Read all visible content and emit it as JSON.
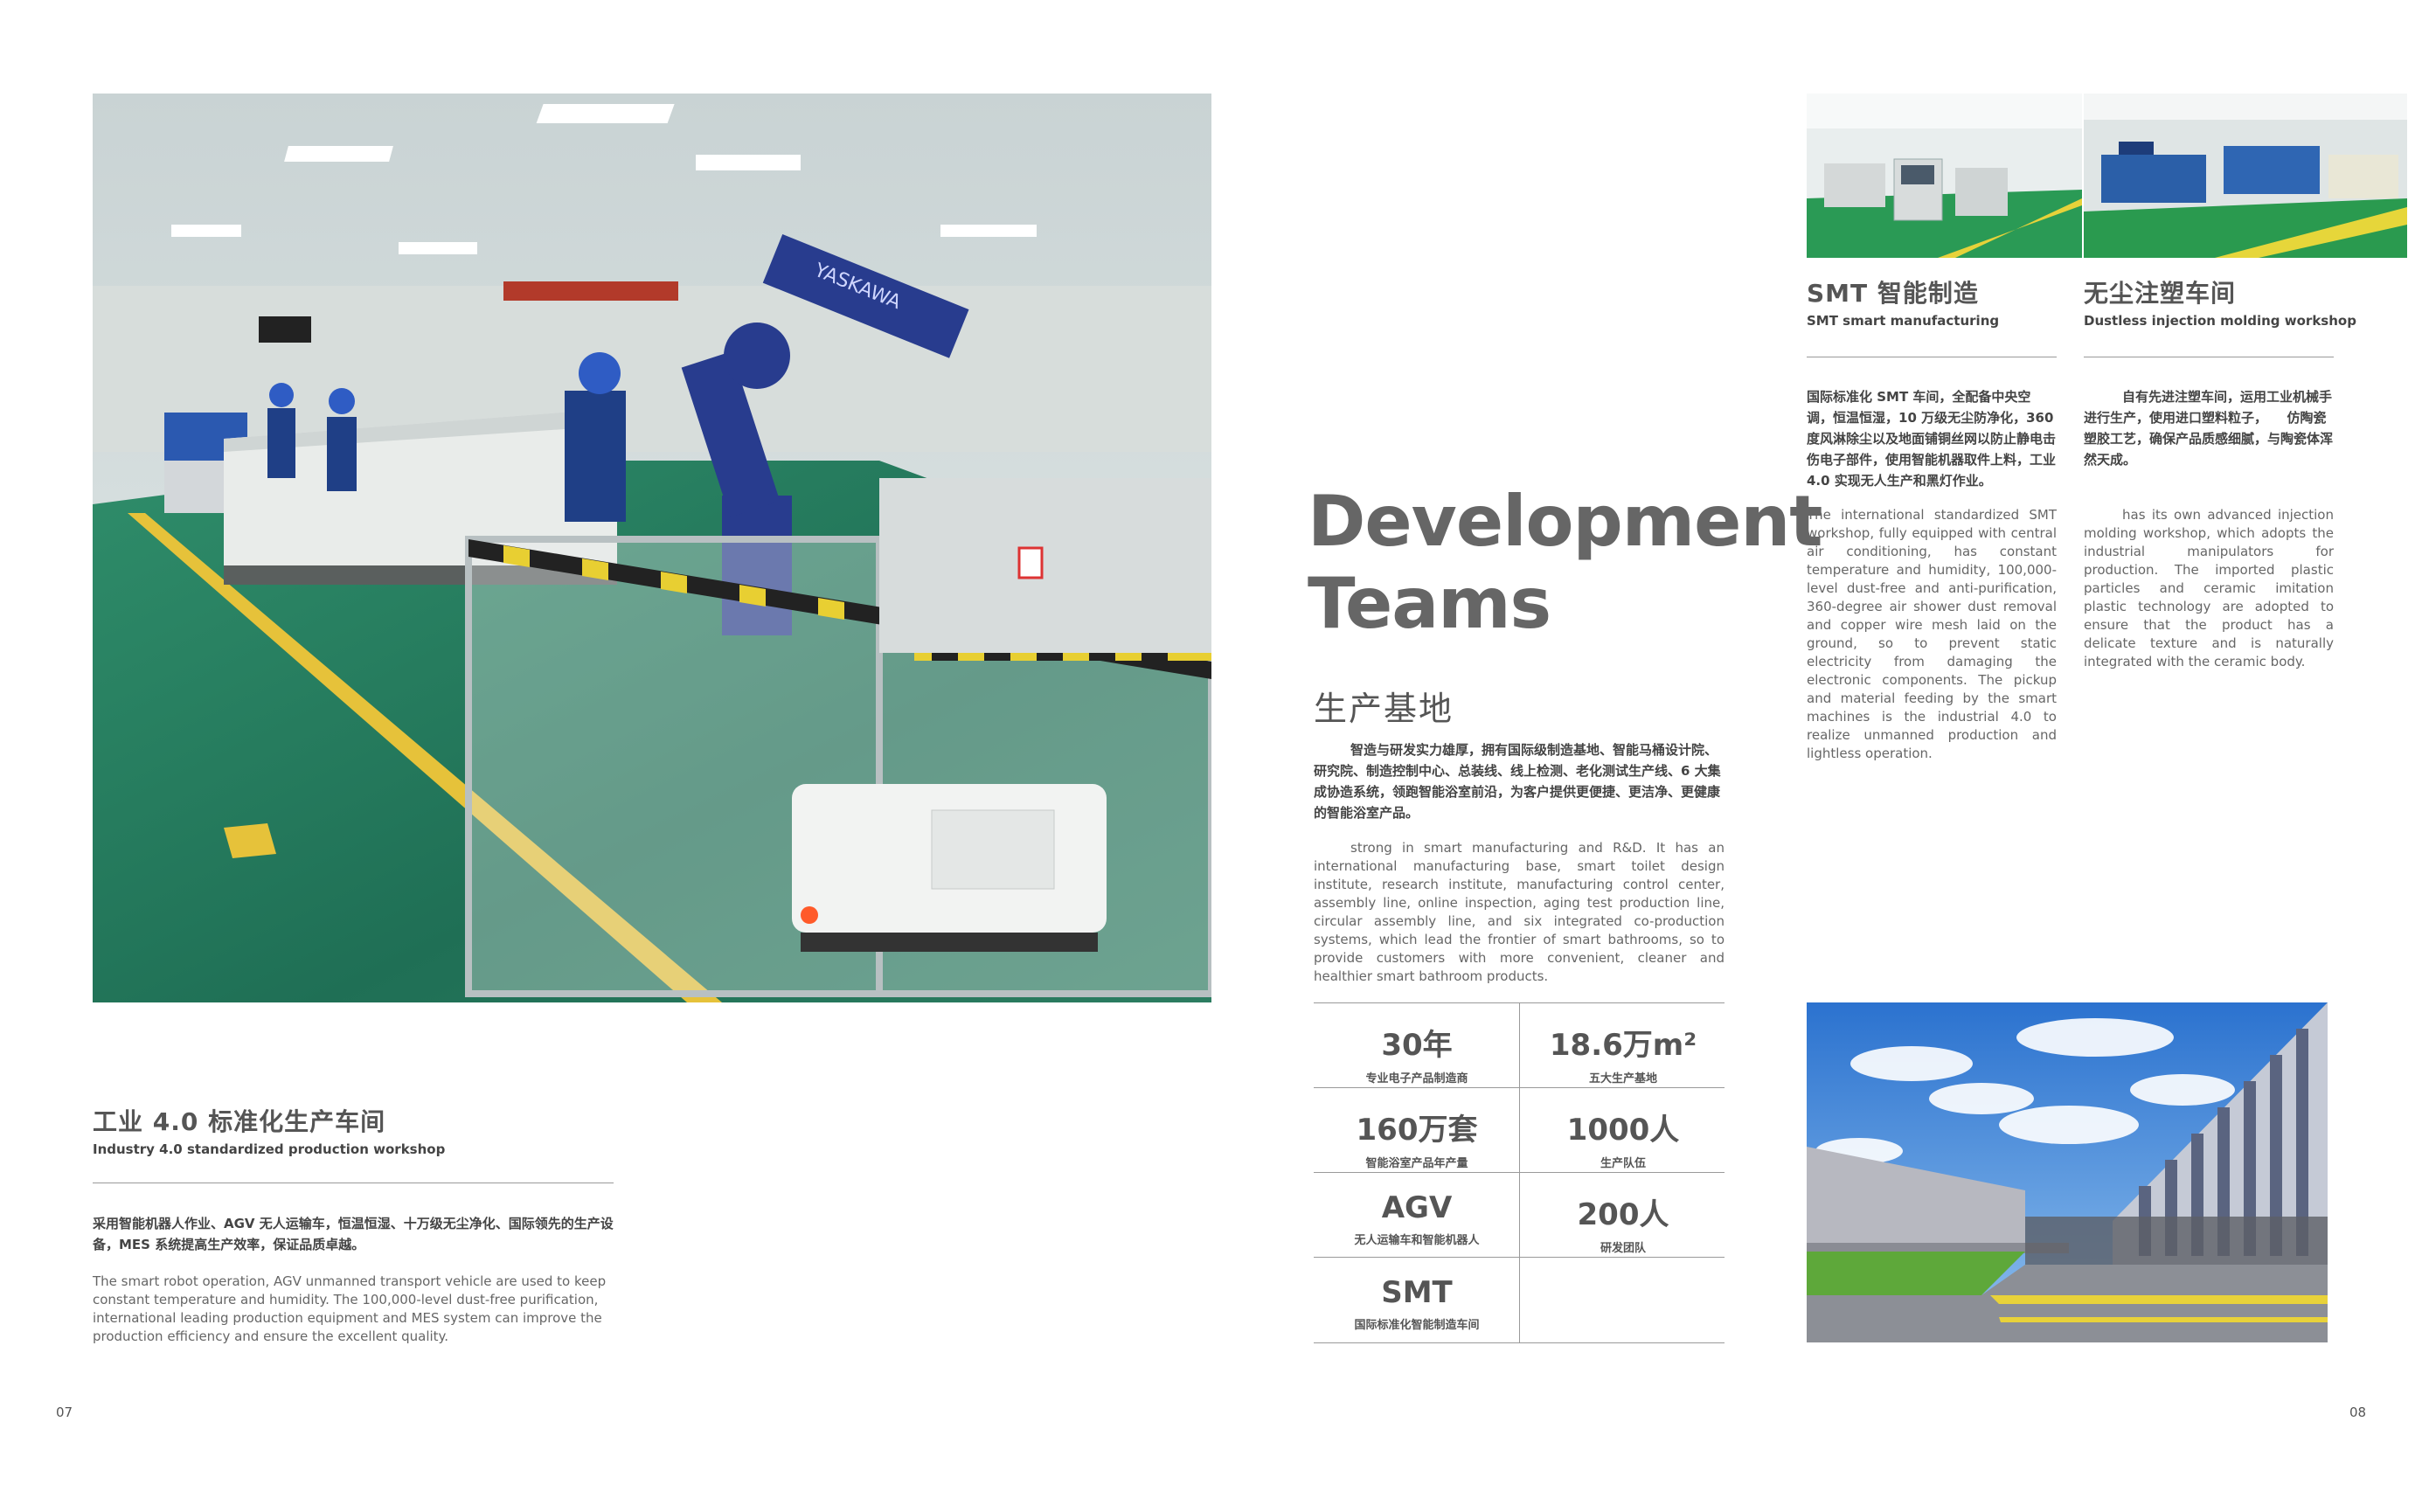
{
  "left_page": {
    "workshop_title_cn": "工业 4.0 标准化生产车间",
    "workshop_title_en": "Industry 4.0 standardized production workshop",
    "workshop_desc_cn": "采用智能机器人作业、AGV 无人运输车，恒温恒湿、十万级无尘净化、国际领先的生产设备，MES 系统提高生产效率，保证品质卓越。",
    "workshop_desc_en": "The smart robot operation, AGV unmanned transport vehicle are used to keep constant temperature and humidity. The 100,000-level dust-free purification, international leading production equipment and MES system can improve the production efficiency and ensure the excellent quality.",
    "page_number": "07",
    "robot_text": "YASKAWA"
  },
  "center": {
    "heading_line1": "Development",
    "heading_line2": "Teams",
    "section_cn": "生产基地",
    "intro_cn": "智造与研发实力雄厚，拥有国际级制造基地、智能马桶设计院、研究院、制造控制中心、总装线、线上检测、老化测试生产线、6 大集成协造系统，领跑智能浴室前沿，为客户提供更便捷、更洁净、更健康的智能浴室产品。",
    "intro_en": "strong in smart manufacturing and R&D. It has an international manufacturing base, smart toilet design institute, research institute, manufacturing control center, assembly line, online inspection, aging test production line, circular assembly line, and six integrated co-production systems, which lead the frontier of smart bathrooms, so to provide customers with more convenient, cleaner and healthier smart bathroom products.",
    "stats": [
      {
        "value": "30年",
        "label": "专业电子产品制造商"
      },
      {
        "value": "18.6万m²",
        "label": "五大生产基地"
      },
      {
        "value": "160万套",
        "label": "智能浴室产品年产量"
      },
      {
        "value": "1000人",
        "label": "生产队伍"
      },
      {
        "value": "AGV",
        "label": "无人运输车和智能机器人"
      },
      {
        "value": "200人",
        "label": "研发团队"
      },
      {
        "value": "SMT",
        "label": "国际标准化智能制造车间"
      }
    ]
  },
  "right_page": {
    "smt_title_cn": "SMT 智能制造",
    "smt_title_en": "SMT smart manufacturing",
    "smt_desc_cn": "国际标准化 SMT 车间，全配备中央空调，恒温恒湿，10 万级无尘防净化，360 度风淋除尘以及地面铺铜丝网以防止静电击伤电子部件，使用智能机器取件上料，工业 4.0 实现无人生产和黑灯作业。",
    "smt_desc_en": "The international standardized SMT workshop, fully equipped with central air conditioning, has constant temperature and humidity, 100,000-level dust-free and anti-purification, 360-degree air shower dust removal and copper wire mesh laid on the ground, so to prevent static electricity from damaging the electronic components. The pickup and material feeding by the smart machines is the industrial 4.0 to realize unmanned production and lightless operation.",
    "molding_title_cn": "无尘注塑车间",
    "molding_title_en": "Dustless injection molding workshop",
    "molding_desc_cn": "自有先进注塑车间，运用工业机械手进行生产，使用进口塑料粒子，　　仿陶瓷塑胶工艺，确保产品质感细腻，与陶瓷体浑然天成。",
    "molding_desc_en": "has its own advanced injection molding workshop, which adopts the industrial manipulators for production. The imported plastic particles and ceramic imitation plastic technology are adopted to ensure that the product has a delicate texture and is naturally integrated with the ceramic body.",
    "page_number": "08"
  }
}
